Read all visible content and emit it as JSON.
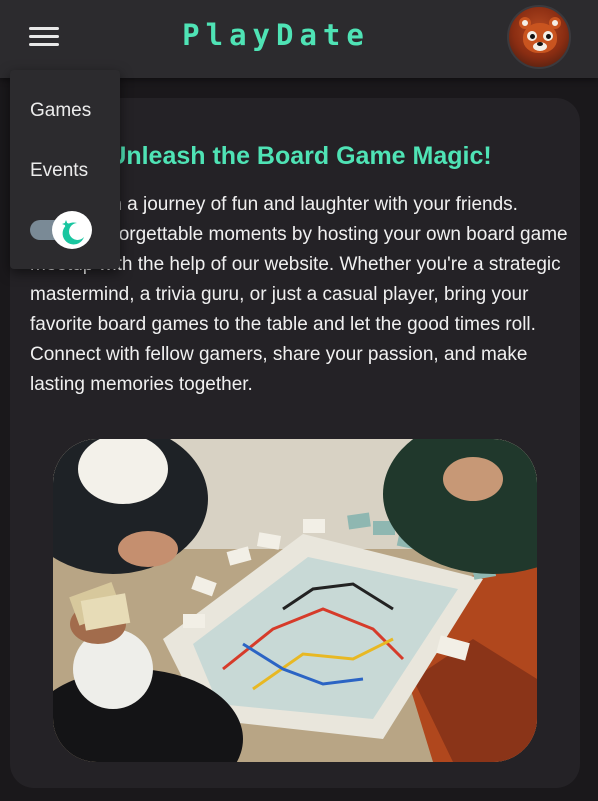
{
  "header": {
    "brand": "PlayDate",
    "menu_icon": "hamburger-icon",
    "avatar_icon": "red-panda-avatar"
  },
  "menu": {
    "items": [
      {
        "label": "Games"
      },
      {
        "label": "Events"
      }
    ],
    "theme_toggle": {
      "icon": "moon-sparkle-icon",
      "state": "dark"
    }
  },
  "hero": {
    "title": "Unleash the Board Game Magic!",
    "text": "Embark on a journey of fun and laughter with your friends. Create unforgettable moments by hosting your own board game meetup with the help of our website. Whether you're a strategic mastermind, a trivia guru, or just a casual player, bring your favorite board games to the table and let the good times roll. Connect with fellow gamers, share your passion, and make lasting memories together."
  },
  "image": {
    "subject": "board-game-table-photo"
  },
  "colors": {
    "accent": "#4fe3b5",
    "background": "#1a181b",
    "card": "#242226",
    "header": "#2c2b2e"
  }
}
